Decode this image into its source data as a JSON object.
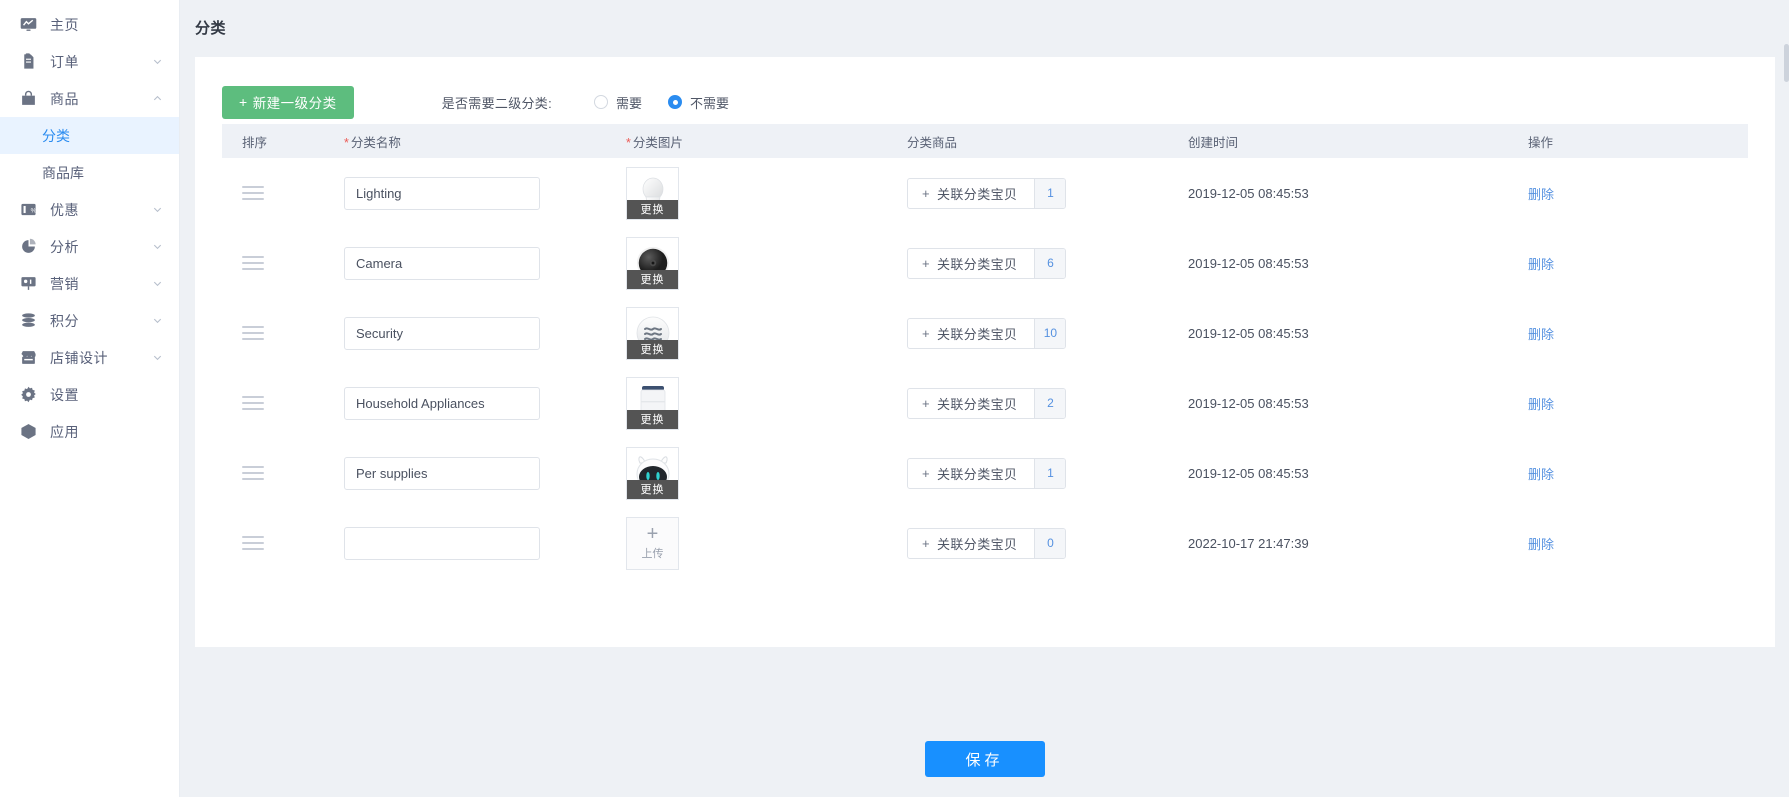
{
  "sidebar": {
    "items": [
      {
        "label": "主页",
        "icon": "dashboard-icon",
        "expandable": false,
        "expanded": false
      },
      {
        "label": "订单",
        "icon": "orders-icon",
        "expandable": true,
        "expanded": false
      },
      {
        "label": "商品",
        "icon": "product-icon",
        "expandable": true,
        "expanded": true
      },
      {
        "label": "优惠",
        "icon": "discount-icon",
        "expandable": true,
        "expanded": false
      },
      {
        "label": "分析",
        "icon": "analytics-icon",
        "expandable": true,
        "expanded": false
      },
      {
        "label": "营销",
        "icon": "marketing-icon",
        "expandable": true,
        "expanded": false
      },
      {
        "label": "积分",
        "icon": "points-icon",
        "expandable": true,
        "expanded": false
      },
      {
        "label": "店铺设计",
        "icon": "shop-design-icon",
        "expandable": true,
        "expanded": false
      },
      {
        "label": "设置",
        "icon": "settings-gear-icon",
        "expandable": false,
        "expanded": false
      },
      {
        "label": "应用",
        "icon": "apps-box-icon",
        "expandable": false,
        "expanded": false
      }
    ],
    "sub_items": [
      {
        "label": "分类",
        "active": true
      },
      {
        "label": "商品库",
        "active": false
      }
    ]
  },
  "header": {
    "title": "分类"
  },
  "toolbar": {
    "new_category_label": "新建一级分类",
    "new_category_plus": "+",
    "sub_category_question": "是否需要二级分类:",
    "options": [
      {
        "label": "需要",
        "checked": false
      },
      {
        "label": "不需要",
        "checked": true
      }
    ]
  },
  "table": {
    "columns": [
      {
        "label": "排序",
        "required": false
      },
      {
        "label": "分类名称",
        "required": true
      },
      {
        "label": "分类图片",
        "required": true
      },
      {
        "label": "分类商品",
        "required": false
      },
      {
        "label": "创建时间",
        "required": false
      },
      {
        "label": "操作",
        "required": false
      }
    ],
    "replace_label": "更换",
    "upload_label": "上传",
    "upload_plus": "+",
    "associate_label": "关联分类宝贝",
    "associate_plus": "+",
    "delete_label": "删除",
    "name_placeholder": "",
    "rows": [
      {
        "name": "Lighting",
        "image": "bulb-thumb",
        "has_image": true,
        "count": "1",
        "created": "2019-12-05 08:45:53"
      },
      {
        "name": "Camera",
        "image": "camera-thumb",
        "has_image": true,
        "count": "6",
        "created": "2019-12-05 08:45:53"
      },
      {
        "name": "Security",
        "image": "sensor-thumb",
        "has_image": true,
        "count": "10",
        "created": "2019-12-05 08:45:53"
      },
      {
        "name": "Household Appliances",
        "image": "purifier-thumb",
        "has_image": true,
        "count": "2",
        "created": "2019-12-05 08:45:53"
      },
      {
        "name": "Per supplies",
        "image": "petrobot-thumb",
        "has_image": true,
        "count": "1",
        "created": "2019-12-05 08:45:53"
      },
      {
        "name": "",
        "image": "",
        "has_image": false,
        "count": "0",
        "created": "2022-10-17 21:47:39"
      }
    ]
  },
  "footer": {
    "save_label": "保存"
  },
  "colors": {
    "primary": "#1890ff",
    "success": "#5dbd7e",
    "link": "#5591e0",
    "required": "#ec5b56",
    "sidebar_active_bg": "#e9f3ff",
    "page_bg": "#eef1f5"
  }
}
